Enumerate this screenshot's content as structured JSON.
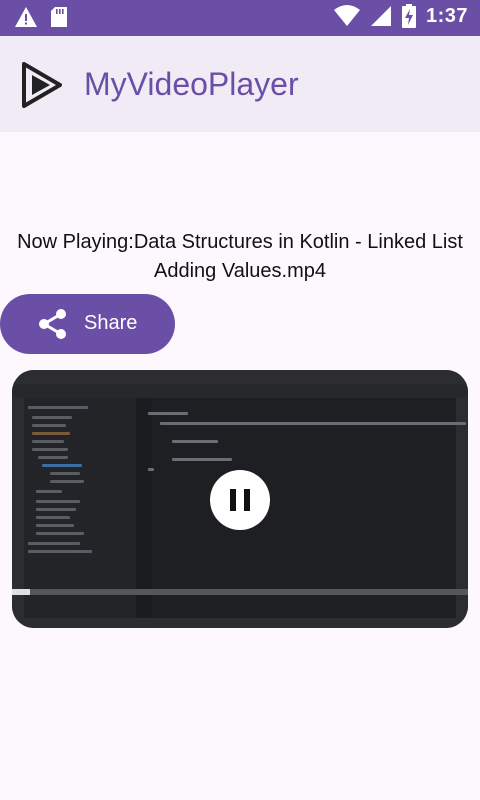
{
  "status_bar": {
    "time": "1:37",
    "left_icons": [
      "warning-icon",
      "sd-card-icon"
    ],
    "right_icons": [
      "wifi-icon",
      "cellular-signal-icon",
      "battery-charging-icon"
    ],
    "background": "#6b4fa6"
  },
  "app_bar": {
    "title": "MyVideoPlayer",
    "logo_icon": "play-logo-icon",
    "title_color": "#6b4fa6",
    "background": "#f0ebf5"
  },
  "now_playing": {
    "text": "Now Playing:Data Structures in Kotlin - Linked List Adding Values.mp4"
  },
  "share_button": {
    "label": "Share",
    "icon": "share-icon",
    "background": "#6b4fa6"
  },
  "video_player": {
    "state": "playing",
    "control_icon": "pause-icon",
    "progress": 0.04
  }
}
